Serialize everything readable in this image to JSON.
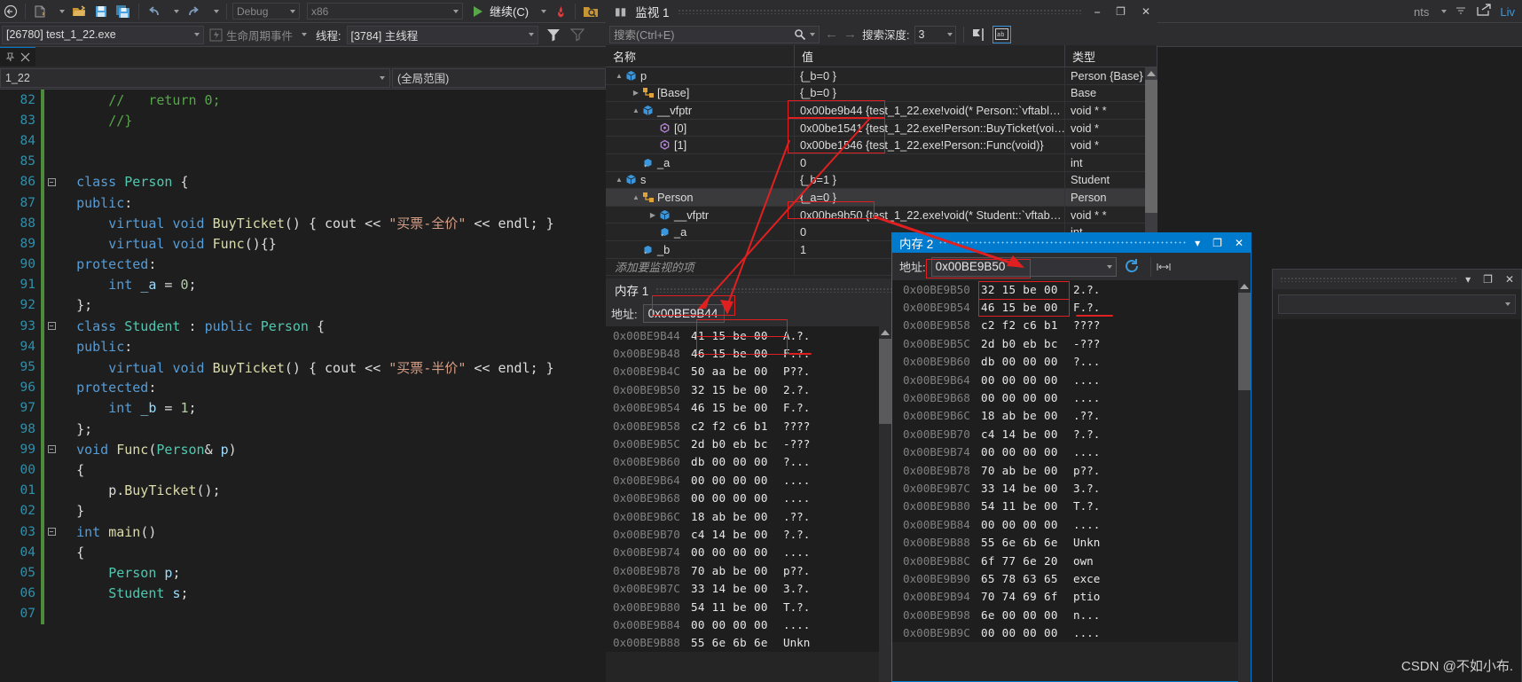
{
  "toolbar": {
    "config_label": "Debug",
    "platform_label": "x86",
    "continue_label": "继续(C)",
    "icons": [
      "back-arrow-icon",
      "new-file-icon",
      "open-file-icon",
      "save-icon",
      "save-all-icon",
      "undo-icon",
      "redo-icon",
      "start-debug-icon",
      "hot-reload-icon",
      "search-window-icon",
      "home-icon"
    ]
  },
  "processbar": {
    "process_value": "[26780] test_1_22.exe",
    "lifecycle_label": "生命周期事件",
    "thread_label": "线程:",
    "thread_value": "[3784] 主线程"
  },
  "editor": {
    "tab_label": "1_22",
    "nav_left_value": "1_22",
    "nav_right_value": "(全局范围)",
    "lines": [
      {
        "n": "82",
        "indent": 1,
        "fold": "",
        "tokens": [
          {
            "t": "// ",
            "c": "com"
          },
          {
            "t": "  return 0;",
            "c": "com"
          }
        ]
      },
      {
        "n": "83",
        "indent": 1,
        "fold": "",
        "tokens": [
          {
            "t": "//}",
            "c": "com"
          }
        ]
      },
      {
        "n": "84",
        "indent": 0,
        "fold": "",
        "tokens": []
      },
      {
        "n": "85",
        "indent": 0,
        "fold": "",
        "tokens": []
      },
      {
        "n": "86",
        "indent": 0,
        "fold": "-",
        "tokens": [
          {
            "t": "class ",
            "c": "kw"
          },
          {
            "t": "Person",
            "c": "typ"
          },
          {
            "t": " {",
            "c": "pl"
          }
        ]
      },
      {
        "n": "87",
        "indent": 0,
        "fold": "",
        "tokens": [
          {
            "t": "public",
            "c": "kw"
          },
          {
            "t": ":",
            "c": "pl"
          }
        ]
      },
      {
        "n": "88",
        "indent": 1,
        "fold": "",
        "tokens": [
          {
            "t": "virtual ",
            "c": "kw"
          },
          {
            "t": "void ",
            "c": "kw"
          },
          {
            "t": "BuyTicket",
            "c": "fn"
          },
          {
            "t": "() { ",
            "c": "pl"
          },
          {
            "t": "cout",
            "c": "ident"
          },
          {
            "t": " << ",
            "c": "pl"
          },
          {
            "t": "\"买票-全价\"",
            "c": "str"
          },
          {
            "t": " << ",
            "c": "pl"
          },
          {
            "t": "endl",
            "c": "ident"
          },
          {
            "t": "; }",
            "c": "pl"
          }
        ]
      },
      {
        "n": "89",
        "indent": 1,
        "fold": "",
        "tokens": [
          {
            "t": "virtual ",
            "c": "kw"
          },
          {
            "t": "void ",
            "c": "kw"
          },
          {
            "t": "Func",
            "c": "fn"
          },
          {
            "t": "(){}",
            "c": "pl"
          }
        ]
      },
      {
        "n": "90",
        "indent": 0,
        "fold": "",
        "tokens": [
          {
            "t": "protected",
            "c": "kw"
          },
          {
            "t": ":",
            "c": "pl"
          }
        ]
      },
      {
        "n": "91",
        "indent": 1,
        "fold": "",
        "tokens": [
          {
            "t": "int ",
            "c": "kw"
          },
          {
            "t": "_a",
            "c": "var"
          },
          {
            "t": " = ",
            "c": "pl"
          },
          {
            "t": "0",
            "c": "num"
          },
          {
            "t": ";",
            "c": "pl"
          }
        ]
      },
      {
        "n": "92",
        "indent": 0,
        "fold": "",
        "tokens": [
          {
            "t": "};",
            "c": "pl"
          }
        ]
      },
      {
        "n": "93",
        "indent": 0,
        "fold": "-",
        "tokens": [
          {
            "t": "class ",
            "c": "kw"
          },
          {
            "t": "Student",
            "c": "typ"
          },
          {
            "t": " : ",
            "c": "pl"
          },
          {
            "t": "public ",
            "c": "kw"
          },
          {
            "t": "Person",
            "c": "typ"
          },
          {
            "t": " {",
            "c": "pl"
          }
        ]
      },
      {
        "n": "94",
        "indent": 0,
        "fold": "",
        "tokens": [
          {
            "t": "public",
            "c": "kw"
          },
          {
            "t": ":",
            "c": "pl"
          }
        ]
      },
      {
        "n": "95",
        "indent": 1,
        "fold": "",
        "tokens": [
          {
            "t": "virtual ",
            "c": "kw"
          },
          {
            "t": "void ",
            "c": "kw"
          },
          {
            "t": "BuyTicket",
            "c": "fn"
          },
          {
            "t": "() { ",
            "c": "pl"
          },
          {
            "t": "cout",
            "c": "ident"
          },
          {
            "t": " << ",
            "c": "pl"
          },
          {
            "t": "\"买票-半价\"",
            "c": "str"
          },
          {
            "t": " << ",
            "c": "pl"
          },
          {
            "t": "endl",
            "c": "ident"
          },
          {
            "t": "; }",
            "c": "pl"
          }
        ]
      },
      {
        "n": "96",
        "indent": 0,
        "fold": "",
        "tokens": [
          {
            "t": "protected",
            "c": "kw"
          },
          {
            "t": ":",
            "c": "pl"
          }
        ]
      },
      {
        "n": "97",
        "indent": 1,
        "fold": "",
        "tokens": [
          {
            "t": "int ",
            "c": "kw"
          },
          {
            "t": "_b",
            "c": "var"
          },
          {
            "t": " = ",
            "c": "pl"
          },
          {
            "t": "1",
            "c": "num"
          },
          {
            "t": ";",
            "c": "pl"
          }
        ]
      },
      {
        "n": "98",
        "indent": 0,
        "fold": "",
        "tokens": [
          {
            "t": "};",
            "c": "pl"
          }
        ]
      },
      {
        "n": "99",
        "indent": 0,
        "fold": "-",
        "tokens": [
          {
            "t": "void ",
            "c": "kw"
          },
          {
            "t": "Func",
            "c": "fn"
          },
          {
            "t": "(",
            "c": "pl"
          },
          {
            "t": "Person",
            "c": "typ"
          },
          {
            "t": "& ",
            "c": "pl"
          },
          {
            "t": "p",
            "c": "var"
          },
          {
            "t": ")",
            "c": "pl"
          }
        ]
      },
      {
        "n": "00",
        "indent": 0,
        "fold": "",
        "tokens": [
          {
            "t": "{",
            "c": "pl"
          }
        ]
      },
      {
        "n": "01",
        "indent": 1,
        "fold": "",
        "tokens": [
          {
            "t": "p",
            "c": "pl"
          },
          {
            "t": ".",
            "c": "pl"
          },
          {
            "t": "BuyTicket",
            "c": "fn"
          },
          {
            "t": "();",
            "c": "pl"
          }
        ]
      },
      {
        "n": "02",
        "indent": 0,
        "fold": "",
        "tokens": [
          {
            "t": "}",
            "c": "pl"
          }
        ]
      },
      {
        "n": "03",
        "indent": 0,
        "fold": "-",
        "tokens": [
          {
            "t": "int ",
            "c": "kw"
          },
          {
            "t": "main",
            "c": "fn"
          },
          {
            "t": "()",
            "c": "pl"
          }
        ]
      },
      {
        "n": "04",
        "indent": 0,
        "fold": "",
        "tokens": [
          {
            "t": "{",
            "c": "pl"
          }
        ]
      },
      {
        "n": "05",
        "indent": 1,
        "fold": "",
        "tokens": [
          {
            "t": "Person",
            "c": "typ"
          },
          {
            "t": " ",
            "c": "pl"
          },
          {
            "t": "p",
            "c": "var"
          },
          {
            "t": ";",
            "c": "pl"
          }
        ]
      },
      {
        "n": "06",
        "indent": 1,
        "fold": "",
        "tokens": [
          {
            "t": "Student",
            "c": "typ"
          },
          {
            "t": " ",
            "c": "pl"
          },
          {
            "t": "s",
            "c": "var"
          },
          {
            "t": ";",
            "c": "pl"
          }
        ]
      },
      {
        "n": "07",
        "indent": 1,
        "fold": "",
        "tokens": []
      }
    ]
  },
  "watch": {
    "title": "监视 1",
    "search_placeholder": "搜索(Ctrl+E)",
    "depth_label": "搜索深度:",
    "depth_value": "3",
    "columns": [
      "名称",
      "值",
      "类型"
    ],
    "add_row_label": "添加要监视的项",
    "rows": [
      {
        "indent": 0,
        "twisty": "▲",
        "icon": "object-icon",
        "name": "p",
        "value": "{_b=0 }",
        "type": "Person {Base}",
        "selected": false,
        "boxed": false
      },
      {
        "indent": 1,
        "twisty": "▶",
        "icon": "base-icon",
        "name": "[Base]",
        "value": "{_b=0 }",
        "type": "Base",
        "selected": false,
        "boxed": false
      },
      {
        "indent": 1,
        "twisty": "▲",
        "icon": "object-icon",
        "name": "__vfptr",
        "value": "0x00be9b44 {test_1_22.exe!void(* Person::`vftabl…",
        "type": "void * *",
        "selected": false,
        "boxed": true
      },
      {
        "indent": 2,
        "twisty": "",
        "icon": "method-icon",
        "name": "[0]",
        "value": "0x00be1541 {test_1_22.exe!Person::BuyTicket(voi…",
        "type": "void *",
        "selected": false,
        "boxed": true
      },
      {
        "indent": 2,
        "twisty": "",
        "icon": "method-icon",
        "name": "[1]",
        "value": "0x00be1546 {test_1_22.exe!Person::Func(void)}",
        "type": "void *",
        "selected": false,
        "boxed": true
      },
      {
        "indent": 1,
        "twisty": "",
        "icon": "field-icon",
        "name": "_a",
        "value": "0",
        "type": "int",
        "selected": false,
        "boxed": false
      },
      {
        "indent": 0,
        "twisty": "▲",
        "icon": "object-icon",
        "name": "s",
        "value": "{_b=1 }",
        "type": "Student",
        "selected": false,
        "boxed": false
      },
      {
        "indent": 1,
        "twisty": "▲",
        "icon": "base-icon",
        "name": "Person",
        "value": "{_a=0 }",
        "type": "Person",
        "selected": true,
        "boxed": false
      },
      {
        "indent": 2,
        "twisty": "▶",
        "icon": "object-icon",
        "name": "__vfptr",
        "value": "0x00be9b50 {test_1_22.exe!void(* Student::`vftab…",
        "type": "void * *",
        "selected": false,
        "boxed": true
      },
      {
        "indent": 2,
        "twisty": "",
        "icon": "field-icon",
        "name": "_a",
        "value": "0",
        "type": "int",
        "selected": false,
        "boxed": false
      },
      {
        "indent": 1,
        "twisty": "",
        "icon": "field-icon",
        "name": "_b",
        "value": "1",
        "type": "",
        "selected": false,
        "boxed": false
      }
    ]
  },
  "memory1": {
    "title": "内存 1",
    "addr_label": "地址:",
    "addr_value": "0x00BE9B44",
    "rows": [
      {
        "addr": "0x00BE9B44",
        "hex": "41 15 be 00",
        "ascii": "A.?."
      },
      {
        "addr": "0x00BE9B48",
        "hex": "46 15 be 00",
        "ascii": "F.?."
      },
      {
        "addr": "0x00BE9B4C",
        "hex": "50 aa be 00",
        "ascii": "P??."
      },
      {
        "addr": "0x00BE9B50",
        "hex": "32 15 be 00",
        "ascii": "2.?."
      },
      {
        "addr": "0x00BE9B54",
        "hex": "46 15 be 00",
        "ascii": "F.?."
      },
      {
        "addr": "0x00BE9B58",
        "hex": "c2 f2 c6 b1",
        "ascii": "????"
      },
      {
        "addr": "0x00BE9B5C",
        "hex": "2d b0 eb bc",
        "ascii": "-???"
      },
      {
        "addr": "0x00BE9B60",
        "hex": "db 00 00 00",
        "ascii": "?..."
      },
      {
        "addr": "0x00BE9B64",
        "hex": "00 00 00 00",
        "ascii": "...."
      },
      {
        "addr": "0x00BE9B68",
        "hex": "00 00 00 00",
        "ascii": "...."
      },
      {
        "addr": "0x00BE9B6C",
        "hex": "18 ab be 00",
        "ascii": ".??."
      },
      {
        "addr": "0x00BE9B70",
        "hex": "c4 14 be 00",
        "ascii": "?.?."
      },
      {
        "addr": "0x00BE9B74",
        "hex": "00 00 00 00",
        "ascii": "...."
      },
      {
        "addr": "0x00BE9B78",
        "hex": "70 ab be 00",
        "ascii": "p??."
      },
      {
        "addr": "0x00BE9B7C",
        "hex": "33 14 be 00",
        "ascii": "3.?."
      },
      {
        "addr": "0x00BE9B80",
        "hex": "54 11 be 00",
        "ascii": "T.?."
      },
      {
        "addr": "0x00BE9B84",
        "hex": "00 00 00 00",
        "ascii": "...."
      },
      {
        "addr": "0x00BE9B88",
        "hex": "55 6e 6b 6e",
        "ascii": "Unkn"
      }
    ]
  },
  "memory2": {
    "title": "内存 2",
    "addr_label": "地址:",
    "addr_value": "0x00BE9B50",
    "rows": [
      {
        "addr": "0x00BE9B50",
        "hex": "32 15 be 00",
        "ascii": "2.?."
      },
      {
        "addr": "0x00BE9B54",
        "hex": "46 15 be 00",
        "ascii": "F.?."
      },
      {
        "addr": "0x00BE9B58",
        "hex": "c2 f2 c6 b1",
        "ascii": "????"
      },
      {
        "addr": "0x00BE9B5C",
        "hex": "2d b0 eb bc",
        "ascii": "-???"
      },
      {
        "addr": "0x00BE9B60",
        "hex": "db 00 00 00",
        "ascii": "?..."
      },
      {
        "addr": "0x00BE9B64",
        "hex": "00 00 00 00",
        "ascii": "...."
      },
      {
        "addr": "0x00BE9B68",
        "hex": "00 00 00 00",
        "ascii": "...."
      },
      {
        "addr": "0x00BE9B6C",
        "hex": "18 ab be 00",
        "ascii": ".??."
      },
      {
        "addr": "0x00BE9B70",
        "hex": "c4 14 be 00",
        "ascii": "?.?."
      },
      {
        "addr": "0x00BE9B74",
        "hex": "00 00 00 00",
        "ascii": "...."
      },
      {
        "addr": "0x00BE9B78",
        "hex": "70 ab be 00",
        "ascii": "p??."
      },
      {
        "addr": "0x00BE9B7C",
        "hex": "33 14 be 00",
        "ascii": "3.?."
      },
      {
        "addr": "0x00BE9B80",
        "hex": "54 11 be 00",
        "ascii": "T.?."
      },
      {
        "addr": "0x00BE9B84",
        "hex": "00 00 00 00",
        "ascii": "...."
      },
      {
        "addr": "0x00BE9B88",
        "hex": "55 6e 6b 6e",
        "ascii": "Unkn"
      },
      {
        "addr": "0x00BE9B8C",
        "hex": "6f 77 6e 20",
        "ascii": "own"
      },
      {
        "addr": "0x00BE9B90",
        "hex": "65 78 63 65",
        "ascii": "exce"
      },
      {
        "addr": "0x00BE9B94",
        "hex": "70 74 69 6f",
        "ascii": "ptio"
      },
      {
        "addr": "0x00BE9B98",
        "hex": "6e 00 00 00",
        "ascii": "n..."
      },
      {
        "addr": "0x00BE9B9C",
        "hex": "00 00 00 00",
        "ascii": "...."
      }
    ]
  },
  "topright": {
    "truncated_menu": "nts",
    "live_label": "Liv"
  },
  "watermark": "CSDN @不如小布.",
  "colors": {
    "accent": "#007acc",
    "annotation": "#e02020",
    "background": "#1e1e1e",
    "panel": "#252526",
    "chrome": "#2d2d30"
  }
}
